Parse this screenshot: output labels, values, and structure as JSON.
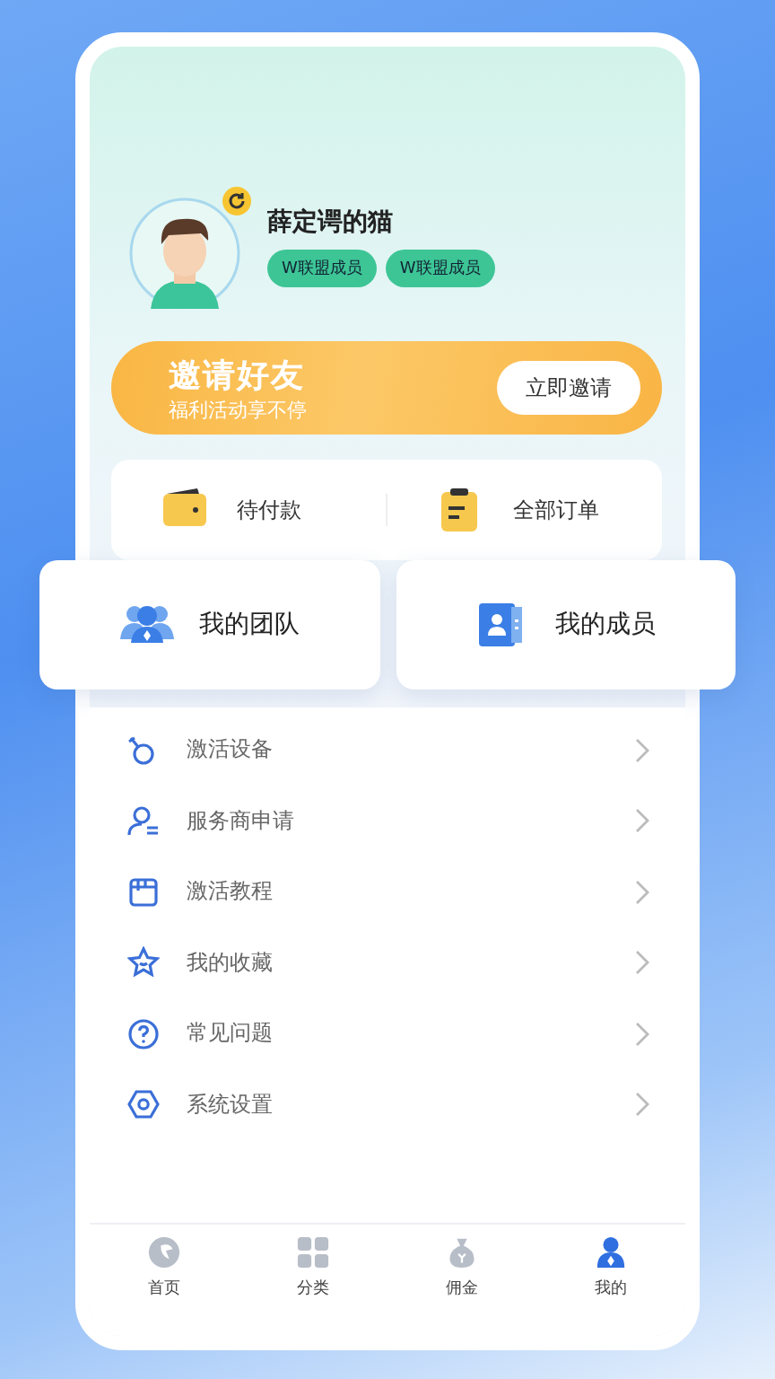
{
  "profile": {
    "name": "薛定谔的猫",
    "tags": [
      "W联盟成员",
      "W联盟成员"
    ]
  },
  "banner": {
    "title": "邀请好友",
    "subtitle": "福利活动享不停",
    "button": "立即邀请"
  },
  "orders": [
    {
      "label": "待付款"
    },
    {
      "label": "全部订单"
    }
  ],
  "team_cards": [
    {
      "label": "我的团队"
    },
    {
      "label": "我的成员"
    }
  ],
  "menu": [
    {
      "label": "激活设备"
    },
    {
      "label": "服务商申请"
    },
    {
      "label": "激活教程"
    },
    {
      "label": "我的收藏"
    },
    {
      "label": "常见问题"
    },
    {
      "label": "系统设置"
    }
  ],
  "tab_bar": [
    {
      "label": "首页",
      "selected": false
    },
    {
      "label": "分类",
      "selected": false
    },
    {
      "label": "佣金",
      "selected": false
    },
    {
      "label": "我的",
      "selected": true
    }
  ]
}
